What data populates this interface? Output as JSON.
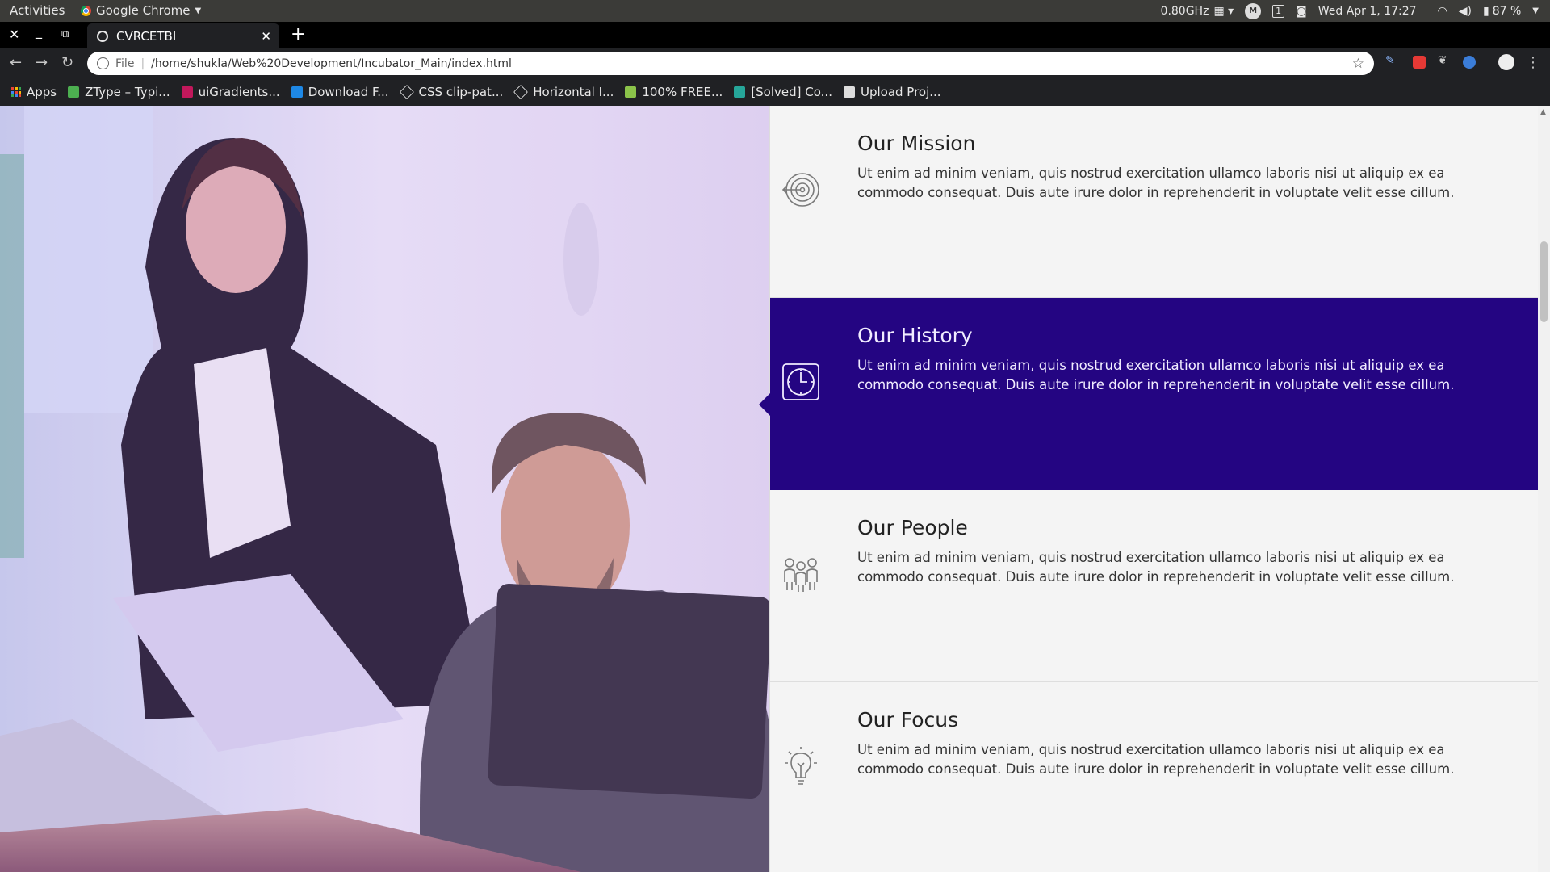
{
  "system_bar": {
    "activities": "Activities",
    "app_name": "Google Chrome",
    "cpu": "0.80GHz",
    "workspace": "1",
    "datetime": "Wed Apr  1, 17:27",
    "battery": "87 %"
  },
  "browser": {
    "tab_title": "CVRCETBI",
    "url_scheme": "File",
    "url": "/home/shukla/Web%20Development/Incubator_Main/index.html",
    "bookmarks": [
      {
        "label": "Apps",
        "icon": "apps-grid-icon",
        "color": "#e53935"
      },
      {
        "label": "ZType – Typi...",
        "icon": "ztype-icon",
        "color": "#4caf50"
      },
      {
        "label": "uiGradients...",
        "icon": "uigradients-icon",
        "color": "#c2185b"
      },
      {
        "label": "Download F...",
        "icon": "download-icon",
        "color": "#1e88e5"
      },
      {
        "label": "CSS clip-pat...",
        "icon": "codepen-icon",
        "color": "#ffffff"
      },
      {
        "label": "Horizontal I...",
        "icon": "codepen-icon",
        "color": "#ffffff"
      },
      {
        "label": "100% FREE...",
        "icon": "feather-icon",
        "color": "#8bc34a"
      },
      {
        "label": "[Solved] Co...",
        "icon": "solved-icon",
        "color": "#26a69a"
      },
      {
        "label": "Upload Proj...",
        "icon": "tm-icon",
        "color": "#dddddd"
      }
    ]
  },
  "sections": [
    {
      "heading": "Our Mission",
      "text": "Ut enim ad minim veniam, quis nostrud exercitation ullamco laboris nisi ut aliquip ex ea commodo consequat. Duis aute irure dolor in reprehenderit in voluptate velit esse cillum.",
      "icon": "target-icon",
      "active": false
    },
    {
      "heading": "Our History",
      "text": "Ut enim ad minim veniam, quis nostrud exercitation ullamco laboris nisi ut aliquip ex ea commodo consequat. Duis aute irure dolor in reprehenderit in voluptate velit esse cillum.",
      "icon": "clock-icon",
      "active": true
    },
    {
      "heading": "Our People",
      "text": "Ut enim ad minim veniam, quis nostrud exercitation ullamco laboris nisi ut aliquip ex ea commodo consequat. Duis aute irure dolor in reprehenderit in voluptate velit esse cillum.",
      "icon": "people-icon",
      "active": false
    },
    {
      "heading": "Our Focus",
      "text": "Ut enim ad minim veniam, quis nostrud exercitation ullamco laboris nisi ut aliquip ex ea commodo consequat. Duis aute irure dolor in reprehenderit in voluptate velit esse cillum.",
      "icon": "lightbulb-icon",
      "active": false
    }
  ],
  "colors": {
    "active_section": "#240582",
    "page_background": "#f4f4f4"
  }
}
